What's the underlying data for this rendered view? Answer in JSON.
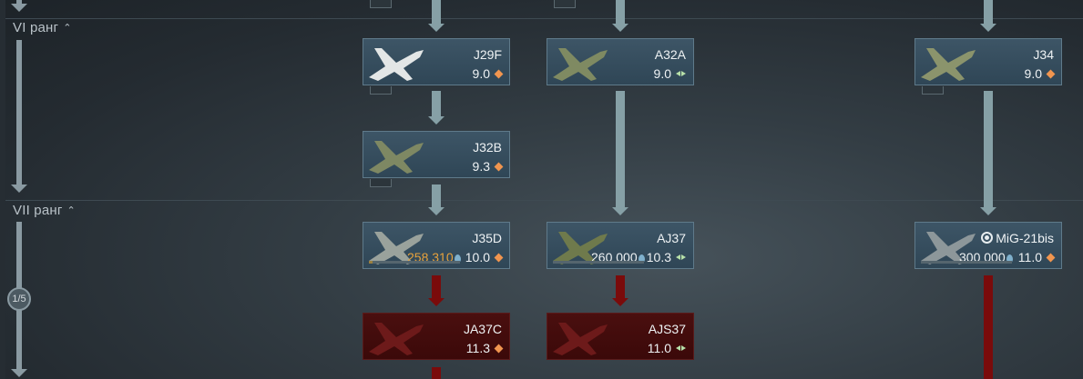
{
  "ranks": [
    {
      "label": "VI ранг"
    },
    {
      "label": "VII ранг"
    }
  ],
  "page_badge": "1/5",
  "vehicles": [
    {
      "name": "J29F",
      "br": "9.0",
      "mode": "diamond",
      "price": ""
    },
    {
      "name": "A32A",
      "br": "9.0",
      "mode": "leaf",
      "price": ""
    },
    {
      "name": "J34",
      "br": "9.0",
      "mode": "diamond",
      "price": ""
    },
    {
      "name": "J32B",
      "br": "9.3",
      "mode": "diamond",
      "price": ""
    },
    {
      "name": "J35D",
      "br": "10.0",
      "mode": "diamond",
      "price": "258 310"
    },
    {
      "name": "AJ37",
      "br": "10.3",
      "mode": "leaf",
      "price": "260 000"
    },
    {
      "name": "MiG-21bis",
      "br": "11.0",
      "mode": "diamond",
      "price": "300 000"
    },
    {
      "name": "JA37C",
      "br": "11.3",
      "mode": "diamond",
      "price": ""
    },
    {
      "name": "AJS37",
      "br": "11.0",
      "mode": "leaf",
      "price": ""
    }
  ],
  "colors": {
    "card_bg": "#34495a",
    "card_locked": "#430c0c",
    "connector": "#86a0a6",
    "connector_locked": "#7a0b0b",
    "br_diamond": "#f0954f",
    "price_research": "#e7a23c"
  }
}
